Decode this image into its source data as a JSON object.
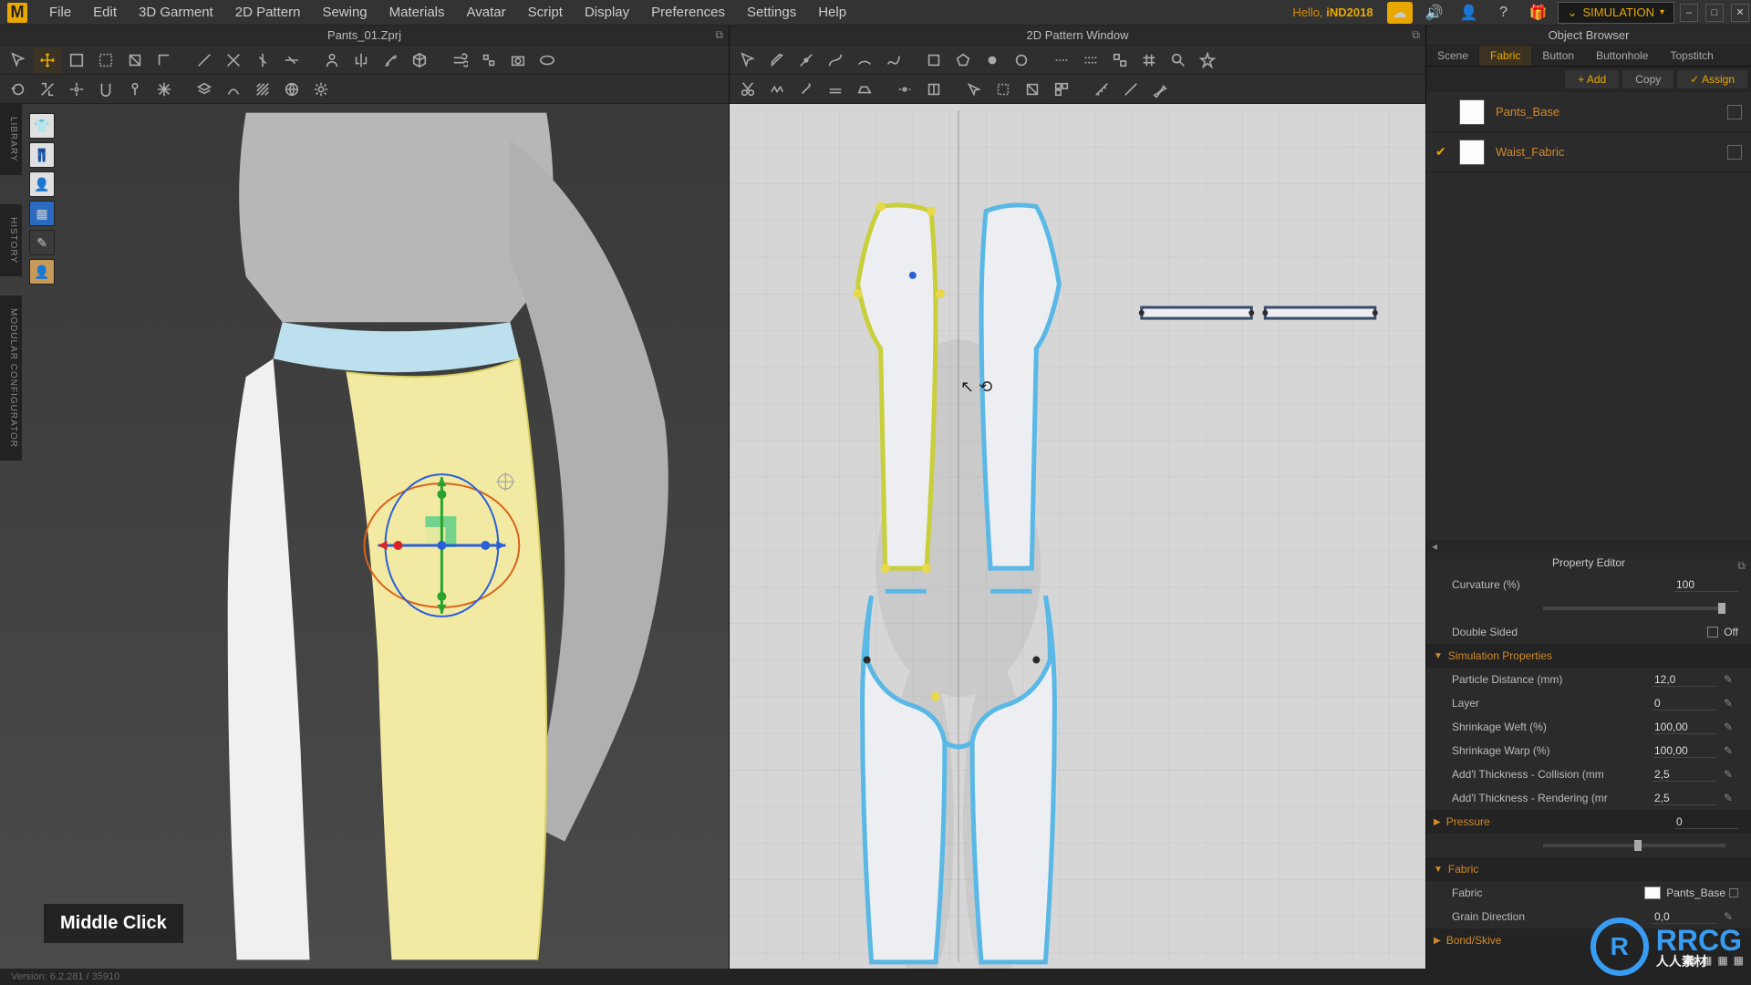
{
  "menubar": [
    "File",
    "Edit",
    "3D Garment",
    "2D Pattern",
    "Sewing",
    "Materials",
    "Avatar",
    "Script",
    "Display",
    "Preferences",
    "Settings",
    "Help"
  ],
  "greeting": "Hello,",
  "username": "iND2018",
  "simulation_label": "SIMULATION",
  "window_controls": [
    "–",
    "□",
    "✕"
  ],
  "header_icons": [
    "cloud",
    "speaker",
    "user",
    "help",
    "gift"
  ],
  "panel_3d_title": "Pants_01.Zprj",
  "panel_2d_title": "2D Pattern Window",
  "panel_ob_title": "Object Browser",
  "panel_prop_title": "Property Editor",
  "side_tabs": [
    "LIBRARY",
    "MODULAR CONFIGURATOR",
    "HISTORY"
  ],
  "key_hint": "Middle Click",
  "toolbar_3d_icons": [
    "cursor",
    "move",
    "select-rect",
    "select-lasso",
    "fold",
    "corner",
    "pointer",
    "edge",
    "face",
    "face-dot",
    "cut-v",
    "cut-h",
    "avatar-size",
    "mirror",
    "xray",
    "bone",
    "camera",
    "light",
    "grid",
    "wire"
  ],
  "toolbar_3d_lower_icons": [
    "rotate",
    "scale",
    "grab",
    "snap",
    "snap-grid",
    "pin",
    "unpin",
    "simulate",
    "freeze",
    "layers",
    "style",
    "hatch",
    "globe",
    "gear",
    "plus",
    "clear"
  ],
  "toolbar_2d_icons": [
    "cursor",
    "pen",
    "point",
    "curve",
    "line",
    "bezier",
    "arc",
    "spline",
    "rect",
    "shape",
    "dot",
    "circle",
    "seam",
    "seam2",
    "pattern",
    "grid",
    "zoom",
    "star",
    "burst"
  ],
  "toolbar_2d_lower_icons": [
    "cut",
    "pin",
    "needle",
    "stitch",
    "hem",
    "iron",
    "seam-edit",
    "fold",
    "arrow",
    "sel",
    "sel2",
    "sel3",
    "measure",
    "diag",
    "grid2",
    "pen2"
  ],
  "ob_tabs": [
    "Scene",
    "Fabric",
    "Button",
    "Buttonhole",
    "Topstitch"
  ],
  "ob_tab_selected": 1,
  "ob_actions": [
    {
      "label": "+ Add",
      "on": true
    },
    {
      "label": "Copy",
      "on": false
    },
    {
      "label": "✓ Assign",
      "on": true
    }
  ],
  "ob_items": [
    {
      "checked": false,
      "name": "Pants_Base"
    },
    {
      "checked": true,
      "name": "Waist_Fabric"
    }
  ],
  "prop": {
    "curvature": {
      "label": "Curvature (%)",
      "value": "100"
    },
    "double_sided": {
      "label": "Double Sided",
      "value": "Off"
    },
    "section_sim": "Simulation Properties",
    "particle": {
      "label": "Particle Distance (mm)",
      "value": "12,0"
    },
    "layer": {
      "label": "Layer",
      "value": "0"
    },
    "shr_weft": {
      "label": "Shrinkage Weft (%)",
      "value": "100,00"
    },
    "shr_warp": {
      "label": "Shrinkage Warp (%)",
      "value": "100,00"
    },
    "coll": {
      "label": "Add'l Thickness - Collision (mm",
      "value": "2,5"
    },
    "rend": {
      "label": "Add'l Thickness - Rendering (mr",
      "value": "2,5"
    },
    "pressure": {
      "label": "Pressure",
      "value": "0"
    },
    "section_fabric": "Fabric",
    "fabric_row": {
      "label": "Fabric",
      "value": "Pants_Base"
    },
    "grain": {
      "label": "Grain Direction",
      "value": "0,0"
    },
    "section_bond": "Bond/Skive"
  },
  "status": "Version: 6.2.281 / 35910",
  "rrcg": {
    "big": "RRCG",
    "sub": "人人素材"
  }
}
